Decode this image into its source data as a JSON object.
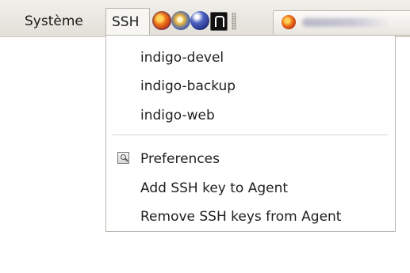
{
  "panel": {
    "menus": {
      "systeme": "Système",
      "ssh": "SSH"
    },
    "launchers": [
      "firefox-icon",
      "thunderbird-icon",
      "globe-icon",
      "terminal-icon"
    ]
  },
  "ssh_menu": {
    "hosts": [
      "indigo-devel",
      "indigo-backup",
      "indigo-web"
    ],
    "actions": {
      "preferences": "Preferences",
      "add_key": "Add SSH key to Agent",
      "remove_keys": "Remove SSH keys from Agent"
    }
  },
  "colors": {
    "panel_background": "#e9e6e0",
    "menu_background": "#ffffff",
    "menu_text": "#1e1e1e",
    "border": "#b9b5ad"
  }
}
